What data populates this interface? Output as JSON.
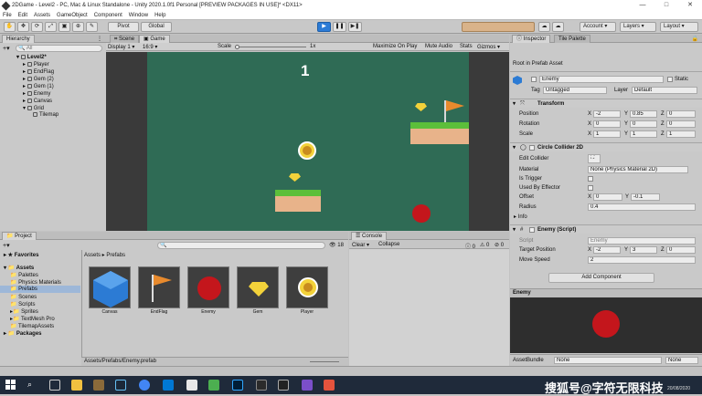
{
  "window": {
    "title": "2DGame - Level2 - PC, Mac & Linux Standalone - Unity 2020.1.0f1 Personal [PREVIEW PACKAGES IN USE]* <DX11>",
    "buttons": [
      "—",
      "□",
      "✕"
    ]
  },
  "menu": [
    "File",
    "Edit",
    "Assets",
    "GameObject",
    "Component",
    "Window",
    "Help"
  ],
  "toolbar": {
    "pivot": "Pivot",
    "global": "Global",
    "account": "Account",
    "layers": "Layers",
    "layout": "Layout",
    "colors": {
      "play_active": "#2b7bd6"
    }
  },
  "hierarchy": {
    "tab": "Hierarchy",
    "search_placeholder": "All",
    "scene": "Level2*",
    "items": [
      "Player",
      "EndFlag",
      "Gem (2)",
      "Gem (1)",
      "Enemy",
      "Canvas",
      "Grid",
      "Tilemap"
    ]
  },
  "game_view": {
    "tab_scene": "Scene",
    "tab_game": "Game",
    "display": "Display 1",
    "aspect": "16:9",
    "scale_label": "Scale",
    "scale_value": "1x",
    "maximize": "Maximize On Play",
    "mute": "Mute Audio",
    "stats": "Stats",
    "gizmos": "Gizmos",
    "score": "1",
    "colors": {
      "background": "#2f6b55",
      "side": "#3a3a3a",
      "grass": "#5cbf3a",
      "dirt": "#e8b38a",
      "enemy": "#c4161c",
      "gem": "#f3d23a",
      "flag": "#e88a2d"
    }
  },
  "project": {
    "tab": "Project",
    "count": "18",
    "favorites": "Favorites",
    "assets_root": "Assets",
    "folders": [
      "Palettes",
      "Physics Materials",
      "Prefabs",
      "Scenes",
      "Scripts",
      "Sprites",
      "TextMesh Pro",
      "TilemapAssets"
    ],
    "packages": "Packages",
    "breadcrumb": [
      "Assets",
      "Prefabs"
    ],
    "assets": [
      "Canvas",
      "EndFlag",
      "Enemy",
      "Gem",
      "Player"
    ],
    "footer_path": "Assets/Prefabs/Enemy.prefab"
  },
  "console": {
    "tab": "Console",
    "clear": "Clear",
    "collapse": "Collapse",
    "counts": [
      "0",
      "0",
      "0"
    ]
  },
  "inspector": {
    "tab_inspector": "Inspector",
    "tab_palette": "Tile Palette",
    "root_label": "Root in Prefab Asset",
    "object_name": "Enemy",
    "static_label": "Static",
    "tag_label": "Tag",
    "tag_value": "Untagged",
    "layer_label": "Layer",
    "layer_value": "Default",
    "transform": {
      "title": "Transform",
      "position_label": "Position",
      "position": [
        "-2",
        "0.85",
        "0"
      ],
      "rotation_label": "Rotation",
      "rotation": [
        "0",
        "0",
        "0"
      ],
      "scale_label": "Scale",
      "scale": [
        "1",
        "1",
        "1"
      ]
    },
    "collider": {
      "title": "Circle Collider 2D",
      "edit_label": "Edit Collider",
      "material_label": "Material",
      "material_value": "None (Physics Material 2D)",
      "trigger_label": "Is Trigger",
      "effector_label": "Used By Effector",
      "offset_label": "Offset",
      "offset": [
        "0",
        "-0.1"
      ],
      "radius_label": "Radius",
      "radius_value": "0.4",
      "info_label": "Info"
    },
    "script": {
      "title": "Enemy (Script)",
      "script_label": "Script",
      "script_value": "Enemy",
      "target_label": "Target Position",
      "target": [
        "-2",
        "3",
        "0"
      ],
      "speed_label": "Move Speed",
      "speed_value": "2"
    },
    "add_component": "Add Component",
    "preview_title": "Enemy",
    "assetbundle_label": "AssetBundle",
    "assetbundle_value": "None",
    "assetbundle_variant": "None",
    "axis": [
      "X",
      "Y",
      "Z"
    ]
  },
  "taskbar": {
    "watermark": "搜狐号@字符无限科技",
    "date": "20/08/2020"
  }
}
